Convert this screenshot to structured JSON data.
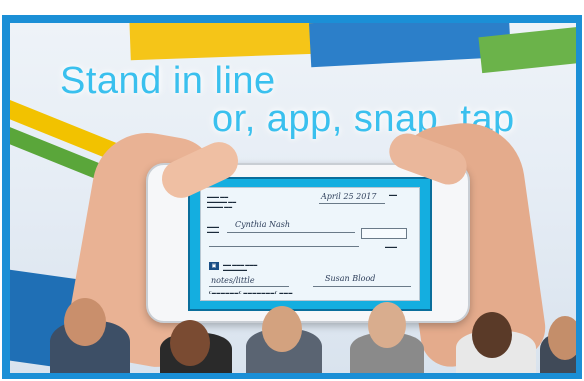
{
  "headline": {
    "line1": "Stand in line",
    "line2": "or, app, snap, tap"
  },
  "colors": {
    "frame": "#1b8fd6",
    "headline": "#3ac0ee",
    "check_screen": "#14aee0"
  },
  "check": {
    "date": "April 25 2017",
    "payee": "Cynthia Nash",
    "memo": "notes/little",
    "signature": "Susan Blood"
  }
}
